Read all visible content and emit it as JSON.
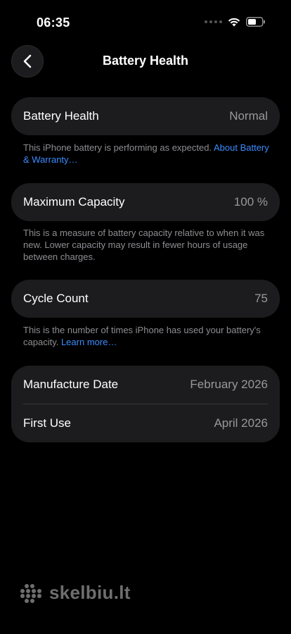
{
  "status_bar": {
    "time": "06:35"
  },
  "nav": {
    "title": "Battery Health",
    "back_icon": "chevron-left-icon"
  },
  "battery_health": {
    "label": "Battery Health",
    "value": "Normal",
    "note_text": "This iPhone battery is performing as expected. ",
    "note_link": "About Battery & Warranty…"
  },
  "maximum_capacity": {
    "label": "Maximum Capacity",
    "value": "100 %",
    "note_text": "This is a measure of battery capacity relative to when it was new. Lower capacity may result in fewer hours of usage between charges."
  },
  "cycle_count": {
    "label": "Cycle Count",
    "value": "75",
    "note_text": "This is the number of times iPhone has used your battery's capacity. ",
    "note_link": "Learn more…"
  },
  "dates": {
    "manufacture_label": "Manufacture Date",
    "manufacture_value": "February 2026",
    "first_use_label": "First Use",
    "first_use_value": "April 2026"
  },
  "watermark": {
    "text": "skelbiu.lt"
  },
  "colors": {
    "background": "#000000",
    "card": "#1c1c1e",
    "secondary_text": "#98989d",
    "link": "#3b8cff"
  }
}
